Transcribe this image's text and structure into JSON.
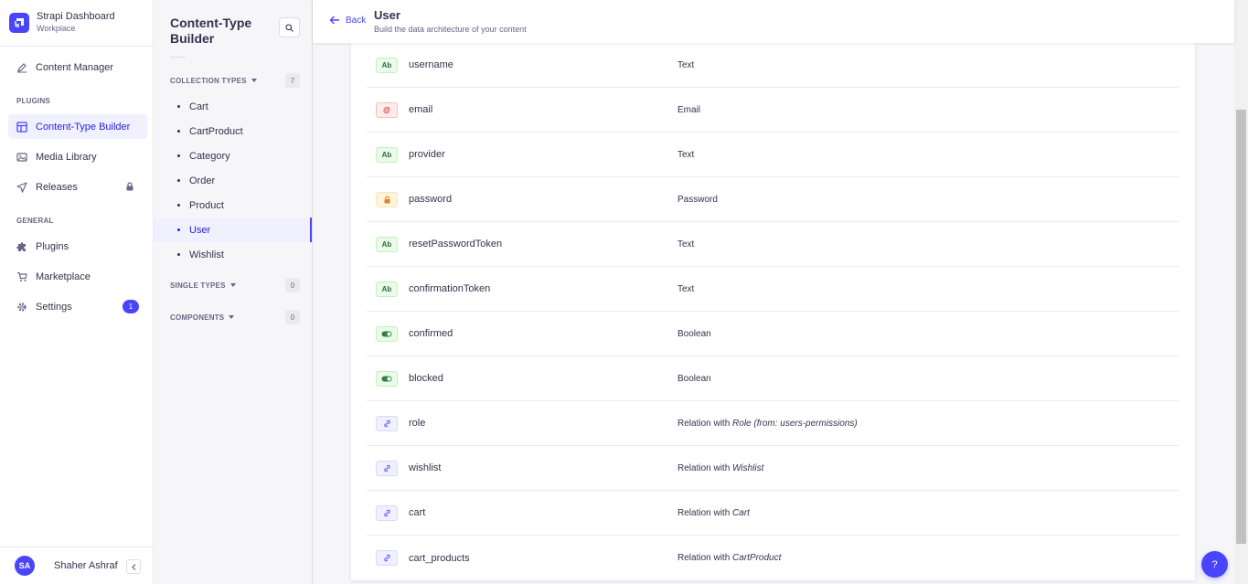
{
  "brand": {
    "title": "Strapi Dashboard",
    "subtitle": "Workplace"
  },
  "mainnav": {
    "content_manager": "Content Manager",
    "plugins_section": "PLUGINS",
    "plugins": [
      {
        "label": "Content-Type Builder",
        "icon": "layout-icon"
      },
      {
        "label": "Media Library",
        "icon": "image-icon"
      },
      {
        "label": "Releases",
        "icon": "paper-plane-icon"
      }
    ],
    "general_section": "GENERAL",
    "general": [
      {
        "label": "Plugins",
        "icon": "puzzle-icon"
      },
      {
        "label": "Marketplace",
        "icon": "cart-icon"
      },
      {
        "label": "Settings",
        "icon": "gear-icon",
        "badge": "1"
      }
    ],
    "user_initials": "SA",
    "user_name": "Shaher Ashraf"
  },
  "subnav": {
    "title": "Content-Type Builder",
    "collection_label": "COLLECTION TYPES",
    "collection_count": "7",
    "collection_types": [
      "Cart",
      "CartProduct",
      "Category",
      "Order",
      "Product",
      "User",
      "Wishlist"
    ],
    "active_type": "User",
    "single_label": "SINGLE TYPES",
    "single_count": "0",
    "components_label": "COMPONENTS",
    "components_count": "0"
  },
  "header": {
    "back_label": "Back",
    "title": "User",
    "subtitle": "Build the data architecture of your content"
  },
  "fields": [
    {
      "name": "username",
      "type": "Text",
      "kind": "text",
      "icon_label": "Ab"
    },
    {
      "name": "email",
      "type": "Email",
      "kind": "email",
      "icon_label": "@"
    },
    {
      "name": "provider",
      "type": "Text",
      "kind": "text",
      "icon_label": "Ab"
    },
    {
      "name": "password",
      "type": "Password",
      "kind": "password",
      "icon_label": ""
    },
    {
      "name": "resetPasswordToken",
      "type": "Text",
      "kind": "text",
      "icon_label": "Ab"
    },
    {
      "name": "confirmationToken",
      "type": "Text",
      "kind": "text",
      "icon_label": "Ab"
    },
    {
      "name": "confirmed",
      "type": "Boolean",
      "kind": "boolean",
      "icon_label": ""
    },
    {
      "name": "blocked",
      "type": "Boolean",
      "kind": "boolean",
      "icon_label": ""
    },
    {
      "name": "role",
      "type": "Relation with ",
      "target": "Role (from: users-permissions)",
      "kind": "relation",
      "icon_label": ""
    },
    {
      "name": "wishlist",
      "type": "Relation with ",
      "target": "Wishlist",
      "kind": "relation",
      "icon_label": ""
    },
    {
      "name": "cart",
      "type": "Relation with ",
      "target": "Cart",
      "kind": "relation",
      "icon_label": ""
    },
    {
      "name": "cart_products",
      "type": "Relation with ",
      "target": "CartProduct",
      "kind": "relation",
      "icon_label": ""
    }
  ],
  "help_label": "?",
  "colors": {
    "primary": "#4945ff",
    "active_bg": "#f0f0ff"
  }
}
